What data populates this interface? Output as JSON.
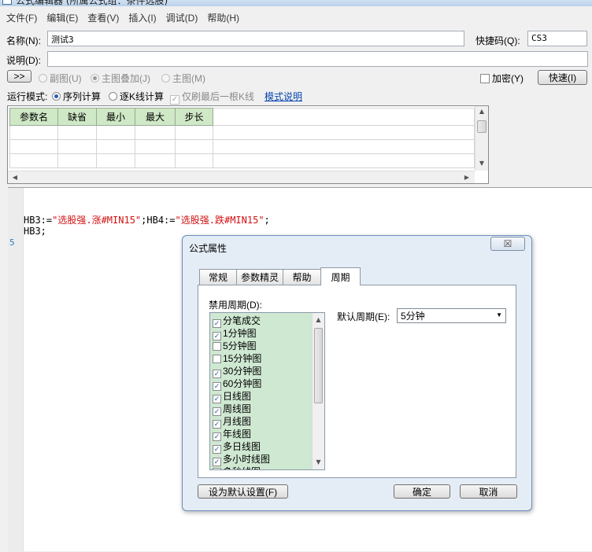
{
  "window": {
    "title": "公式编辑器 (所属公式组：条件选股)"
  },
  "menu": [
    "文件(F)",
    "编辑(E)",
    "查看(V)",
    "插入(I)",
    "调试(D)",
    "帮助(H)"
  ],
  "form": {
    "name_label": "名称(N):",
    "name_value": "测试3",
    "shortcut_label": "快捷码(Q):",
    "shortcut_value": "CS3",
    "desc_label": "说明(D):",
    "desc_value": "",
    "expand_button": ">>",
    "radio_sub": "副图(U)",
    "radio_overlay": "主图叠加(J)",
    "radio_main": "主图(M)",
    "encrypt_label": "加密(Y)",
    "quick_button": "快速(I)"
  },
  "run_mode": {
    "label": "运行模式:",
    "sequential": "序列计算",
    "per_kline": "逐K线计算",
    "last_only": "仅刷最后一根K线",
    "help_link": "模式说明"
  },
  "params_table": {
    "headers": [
      "参数名",
      "缺省",
      "最小",
      "最大",
      "步长"
    ],
    "rows": [
      [
        "",
        "",
        "",
        "",
        ""
      ],
      [
        "",
        "",
        "",
        "",
        ""
      ],
      [
        "",
        "",
        "",
        "",
        ""
      ]
    ]
  },
  "editor": {
    "line1_a": "HB3:=",
    "line1_s1": "\"选股强.涨#MIN15\"",
    "line1_b": ";HB4:=",
    "line1_s2": "\"选股强.跌#MIN15\"",
    "line1_c": ";",
    "line2": "HB3;",
    "gutter_number": "5"
  },
  "dialog": {
    "title": "公式属性",
    "close_glyph": "☒",
    "tabs": [
      "常规",
      "参数精灵",
      "帮助",
      "周期"
    ],
    "active_tab": "周期",
    "disabled_period_label": "禁用周期(D):",
    "default_period_label": "默认周期(E):",
    "default_period_value": "5分钟",
    "periods": [
      {
        "label": "分笔成交",
        "checked": true
      },
      {
        "label": "1分钟图",
        "checked": true
      },
      {
        "label": "5分钟图",
        "checked": false
      },
      {
        "label": "15分钟图",
        "checked": false
      },
      {
        "label": "30分钟图",
        "checked": true
      },
      {
        "label": "60分钟图",
        "checked": true
      },
      {
        "label": "日线图",
        "checked": true
      },
      {
        "label": "周线图",
        "checked": true
      },
      {
        "label": "月线图",
        "checked": true
      },
      {
        "label": "年线图",
        "checked": true
      },
      {
        "label": "多日线图",
        "checked": true
      },
      {
        "label": "多小时线图",
        "checked": true
      },
      {
        "label": "多秒线图",
        "checked": false
      }
    ],
    "set_default_button": "设为默认设置(F)",
    "ok_button": "确定",
    "cancel_button": "取消"
  }
}
